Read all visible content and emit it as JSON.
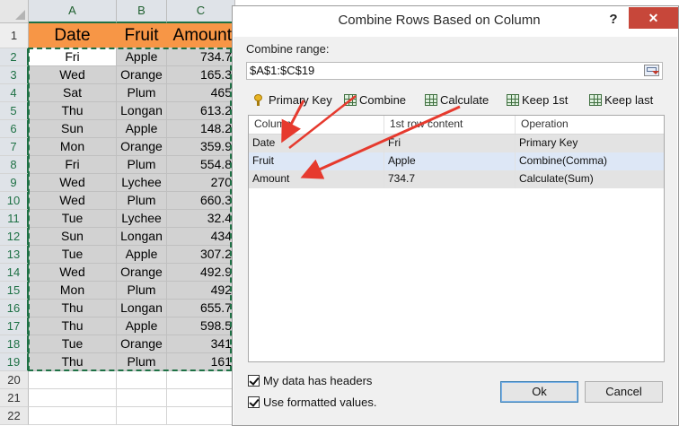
{
  "sheet": {
    "columns": [
      "A",
      "B",
      "C"
    ],
    "headers": [
      "Date",
      "Fruit",
      "Amount"
    ],
    "rows": [
      {
        "n": "2",
        "date": "Fri",
        "fruit": "Apple",
        "amount": "734.7"
      },
      {
        "n": "3",
        "date": "Wed",
        "fruit": "Orange",
        "amount": "165.3"
      },
      {
        "n": "4",
        "date": "Sat",
        "fruit": "Plum",
        "amount": "465"
      },
      {
        "n": "5",
        "date": "Thu",
        "fruit": "Longan",
        "amount": "613.2"
      },
      {
        "n": "6",
        "date": "Sun",
        "fruit": "Apple",
        "amount": "148.2"
      },
      {
        "n": "7",
        "date": "Mon",
        "fruit": "Orange",
        "amount": "359.9"
      },
      {
        "n": "8",
        "date": "Fri",
        "fruit": "Plum",
        "amount": "554.8"
      },
      {
        "n": "9",
        "date": "Wed",
        "fruit": "Lychee",
        "amount": "270"
      },
      {
        "n": "10",
        "date": "Wed",
        "fruit": "Plum",
        "amount": "660.3"
      },
      {
        "n": "11",
        "date": "Tue",
        "fruit": "Lychee",
        "amount": "32.4"
      },
      {
        "n": "12",
        "date": "Sun",
        "fruit": "Longan",
        "amount": "434"
      },
      {
        "n": "13",
        "date": "Tue",
        "fruit": "Apple",
        "amount": "307.2"
      },
      {
        "n": "14",
        "date": "Wed",
        "fruit": "Orange",
        "amount": "492.9"
      },
      {
        "n": "15",
        "date": "Mon",
        "fruit": "Plum",
        "amount": "492"
      },
      {
        "n": "16",
        "date": "Thu",
        "fruit": "Longan",
        "amount": "655.7"
      },
      {
        "n": "17",
        "date": "Thu",
        "fruit": "Apple",
        "amount": "598.5"
      },
      {
        "n": "18",
        "date": "Tue",
        "fruit": "Orange",
        "amount": "341"
      },
      {
        "n": "19",
        "date": "Thu",
        "fruit": "Plum",
        "amount": "161"
      }
    ],
    "row_numbers": [
      "1",
      "2",
      "3",
      "4",
      "5",
      "6",
      "7",
      "8",
      "9",
      "10",
      "11",
      "12",
      "13",
      "14",
      "15",
      "16",
      "17",
      "18",
      "19",
      "20",
      "21",
      "22"
    ],
    "header_color": "#f79646",
    "selection_color": "#1e7145"
  },
  "dialog": {
    "title": "Combine Rows Based on Column",
    "help_label": "?",
    "close_label": "✕",
    "range_label": "Combine range:",
    "range_value": "$A$1:$C$19",
    "toolbar": {
      "primary_key": "Primary Key",
      "combine": "Combine",
      "calculate": "Calculate",
      "keep_first": "Keep 1st",
      "keep_last": "Keep last"
    },
    "grid": {
      "columns": [
        "Column",
        "1st row content",
        "Operation"
      ],
      "rows": [
        {
          "column": "Date",
          "first": "Fri",
          "operation": "Primary Key"
        },
        {
          "column": "Fruit",
          "first": "Apple",
          "operation": "Combine(Comma)"
        },
        {
          "column": "Amount",
          "first": "734.7",
          "operation": "Calculate(Sum)"
        }
      ]
    },
    "cb_headers": "My data has headers",
    "cb_formatted": "Use formatted values.",
    "ok_label": "Ok",
    "cancel_label": "Cancel",
    "arrow_color": "#e63a2e"
  }
}
